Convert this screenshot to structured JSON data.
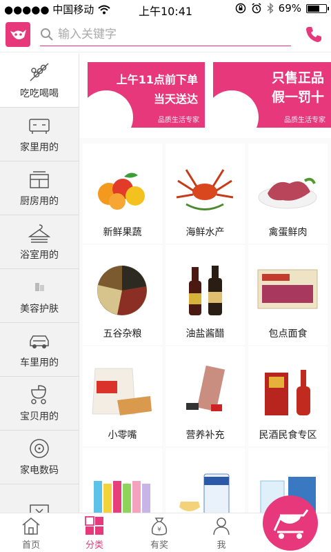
{
  "status": {
    "carrier": "●●●●● 中国移动",
    "time": "上午10:41",
    "battery": "69%",
    "battery_level": 0.69
  },
  "search": {
    "placeholder": "输入关键字"
  },
  "sidebar": {
    "items": [
      {
        "label": "吃吃喝喝",
        "icon": "skewer-icon",
        "active": true
      },
      {
        "label": "家里用的",
        "icon": "tv-cabinet-icon"
      },
      {
        "label": "厨房用的",
        "icon": "stove-icon"
      },
      {
        "label": "浴室用的",
        "icon": "hanger-icon"
      },
      {
        "label": "美容护肤",
        "icon": "cosmetics-icon"
      },
      {
        "label": "车里用的",
        "icon": "car-icon"
      },
      {
        "label": "宝贝用的",
        "icon": "stroller-icon"
      },
      {
        "label": "家电数码",
        "icon": "appliance-icon"
      },
      {
        "label": "",
        "icon": "ticket-icon"
      }
    ]
  },
  "banners": [
    {
      "line1": "上午11点前下单",
      "line2": "当天送达",
      "tag": "品质生活专家"
    },
    {
      "line1": "只售正品",
      "line2": "假一罚十",
      "tag": "品质生活专家"
    }
  ],
  "categories": [
    {
      "name": "新鲜果蔬",
      "icon": "fruit-icon"
    },
    {
      "name": "海鲜水产",
      "icon": "crab-icon"
    },
    {
      "name": "禽蛋鲜肉",
      "icon": "meat-icon"
    },
    {
      "name": "五谷杂粮",
      "icon": "grains-icon"
    },
    {
      "name": "油盐酱醋",
      "icon": "soy-sauce-icon"
    },
    {
      "name": "包点面食",
      "icon": "dumpling-box-icon"
    },
    {
      "name": "小零嘴",
      "icon": "snack-icon"
    },
    {
      "name": "营养补充",
      "icon": "supplement-icon"
    },
    {
      "name": "民酒民食专区",
      "icon": "liquor-icon"
    },
    {
      "name": "",
      "icon": "cocktail-bottles-icon"
    },
    {
      "name": "",
      "icon": "milk-powder-icon"
    },
    {
      "name": "",
      "icon": "water-bottle-icon"
    }
  ],
  "tabs": [
    {
      "label": "首页",
      "icon": "home-icon"
    },
    {
      "label": "分类",
      "icon": "category-grid-icon",
      "active": true
    },
    {
      "label": "有奖",
      "icon": "reward-bag-icon"
    },
    {
      "label": "我",
      "icon": "user-icon"
    }
  ],
  "colors": {
    "accent": "#e8387c",
    "sidebar_bg": "#f2f2f2"
  }
}
